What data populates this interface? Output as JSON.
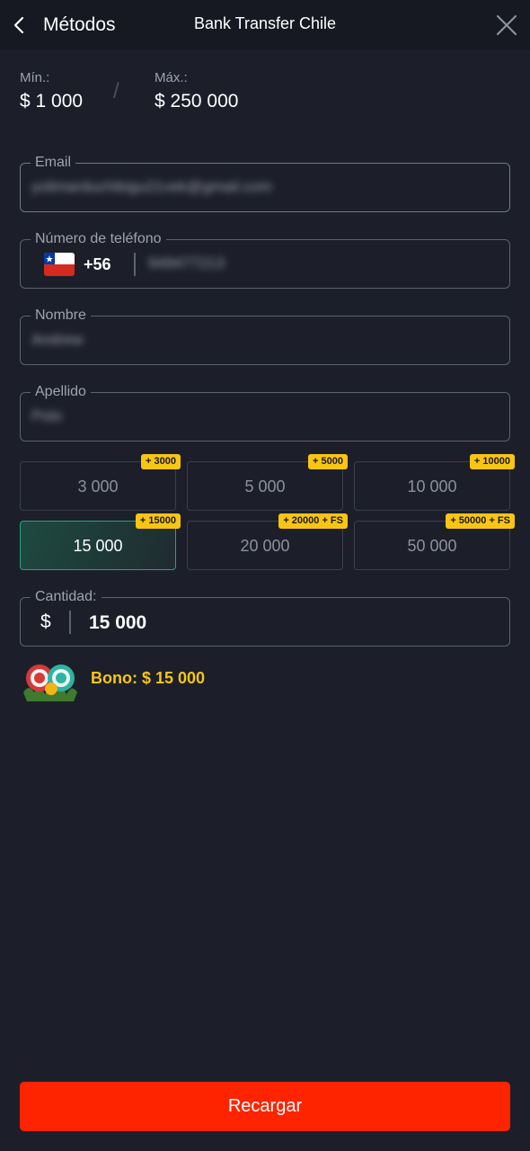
{
  "header": {
    "back_label": "Métodos",
    "title": "Bank Transfer Chile"
  },
  "limits": {
    "min_label": "Mín.:",
    "min_value": "$ 1 000",
    "separator": "/",
    "max_label": "Máx.:",
    "max_value": "$ 250 000"
  },
  "form": {
    "email": {
      "label": "Email",
      "value": "yolimarduchibigu21vek@gmail.com"
    },
    "phone": {
      "label": "Número de teléfono",
      "country": "Chile",
      "dial_code": "+56",
      "value": "949477213"
    },
    "first_name": {
      "label": "Nombre",
      "value": "Andrew"
    },
    "last_name": {
      "label": "Apellido",
      "value": "Polo"
    }
  },
  "amount_options": [
    {
      "amount": "3 000",
      "badge": "+ 3000",
      "selected": false
    },
    {
      "amount": "5 000",
      "badge": "+ 5000",
      "selected": false
    },
    {
      "amount": "10 000",
      "badge": "+ 10000",
      "selected": false
    },
    {
      "amount": "15 000",
      "badge": "+ 15000",
      "selected": true
    },
    {
      "amount": "20 000",
      "badge": "+ 20000 + FS",
      "selected": false
    },
    {
      "amount": "50 000",
      "badge": "+ 50000 + FS",
      "selected": false
    }
  ],
  "amount": {
    "label": "Cantidad:",
    "currency": "$",
    "value": "15 000"
  },
  "bonus": {
    "text": "Bono: $ 15 000"
  },
  "submit": {
    "label": "Recargar"
  },
  "colors": {
    "background": "#1c1f2a",
    "header_bg": "#161922",
    "accent_green": "#27a37c",
    "badge_yellow": "#f9c514",
    "submit_red": "#ff2400"
  },
  "icons": {
    "back": "chevron-left-icon",
    "close": "close-icon",
    "flag": "chile-flag-icon",
    "bonus": "casino-chips-icon"
  }
}
